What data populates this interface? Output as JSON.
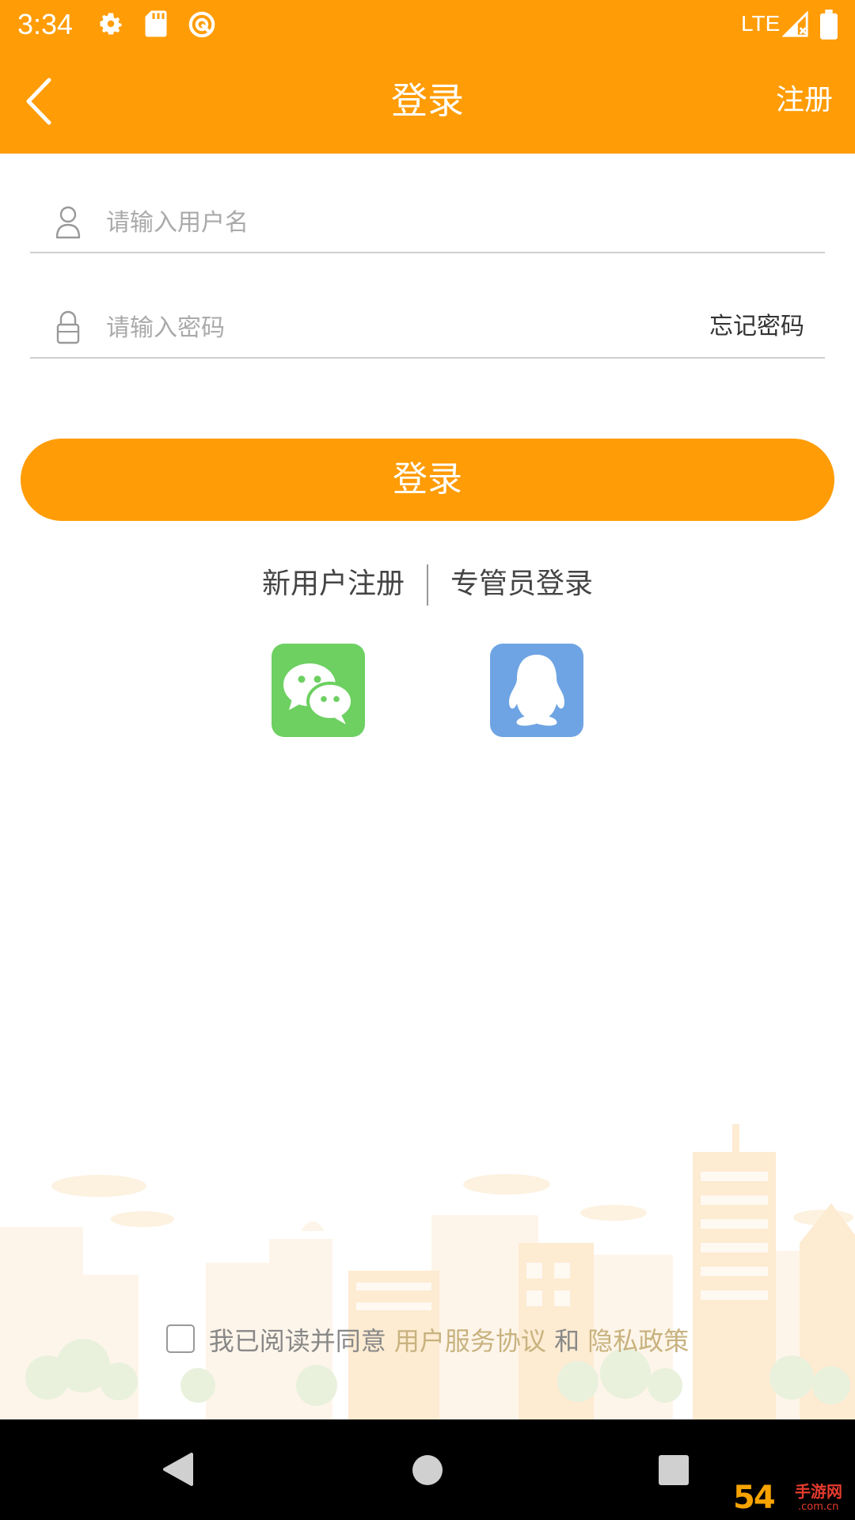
{
  "status_bar": {
    "time": "3:34",
    "network": "LTE",
    "icons": [
      "gear-icon",
      "sd-card-icon",
      "sync-circle-icon",
      "signal-icon",
      "battery-icon"
    ]
  },
  "app_bar": {
    "title": "登录",
    "action": "注册",
    "back_icon": "chevron-left-icon"
  },
  "form": {
    "username_placeholder": "请输入用户名",
    "password_placeholder": "请输入密码",
    "forgot_password": "忘记密码",
    "login_button": "登录"
  },
  "links": {
    "new_user": "新用户注册",
    "admin_login": "专管员登录"
  },
  "social": [
    "wechat-icon",
    "qq-icon"
  ],
  "agreement": {
    "prefix": "我已阅读并同意",
    "terms": "用户服务协议",
    "and": "和",
    "privacy": "隐私政策",
    "checked": false
  },
  "watermark": {
    "number": "54",
    "text": "手游网",
    "domain": ".com.cn"
  },
  "colors": {
    "primary": "#FF9C06",
    "wechat": "#6DD061",
    "qq": "#6EA4E3",
    "link_highlight": "#C8B27E"
  }
}
